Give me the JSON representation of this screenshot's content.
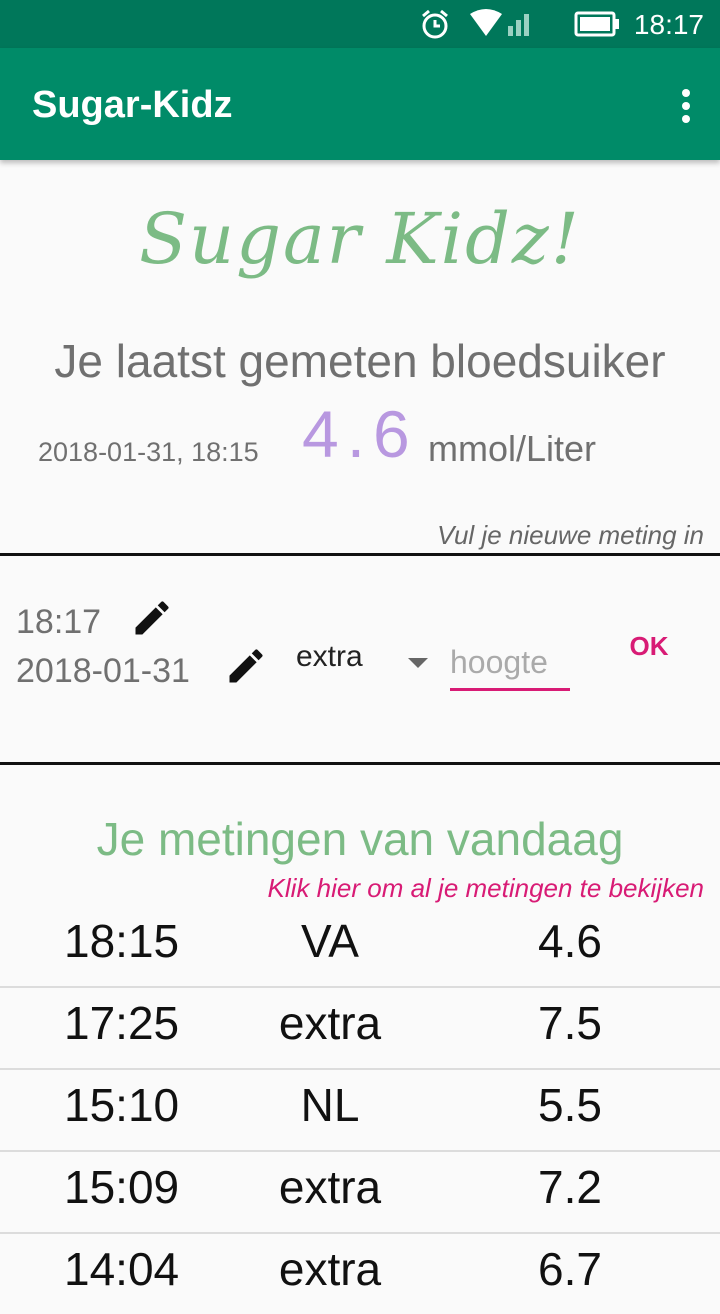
{
  "status": {
    "time": "18:17"
  },
  "appbar": {
    "title": "Sugar-Kidz"
  },
  "brand": "Sugar Kidz!",
  "last": {
    "heading": "Je laatst gemeten bloedsuiker",
    "date": "2018-01-31, 18:15",
    "value": "4.6",
    "unit": "mmol/Liter"
  },
  "entry": {
    "hint": "Vul je nieuwe meting in",
    "time": "18:17",
    "date": "2018-01-31",
    "type": "extra",
    "height_placeholder": "hoogte",
    "ok_label": "OK"
  },
  "today": {
    "title": "Je metingen van vandaag",
    "link": "Klik hier om al je metingen te bekijken",
    "rows": [
      {
        "time": "18:15",
        "type": "VA",
        "value": "4.6"
      },
      {
        "time": "17:25",
        "type": "extra",
        "value": "7.5"
      },
      {
        "time": "15:10",
        "type": "NL",
        "value": "5.5"
      },
      {
        "time": "15:09",
        "type": "extra",
        "value": "7.2"
      },
      {
        "time": "14:04",
        "type": "extra",
        "value": "6.7"
      }
    ]
  },
  "colors": {
    "primary": "#008b68",
    "primary_dark": "#00775a",
    "accent": "#d81b75",
    "green_text": "#7cbb85",
    "value_purple": "#b898e0"
  }
}
